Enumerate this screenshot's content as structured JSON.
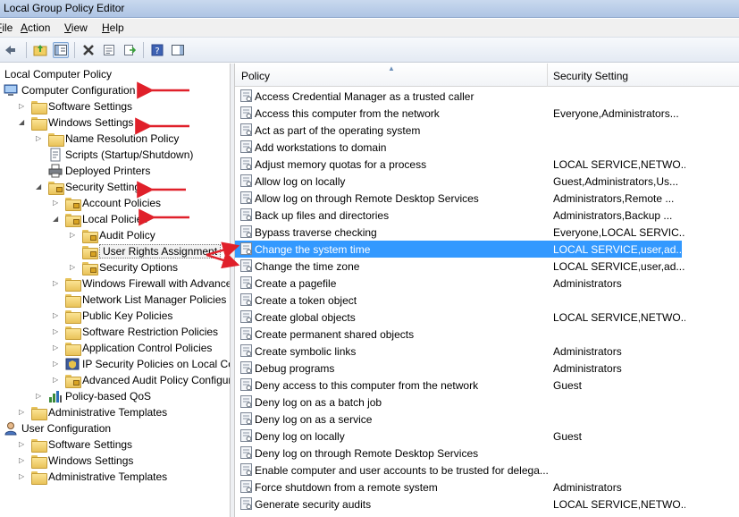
{
  "window": {
    "title": "Local Group Policy Editor"
  },
  "menu": {
    "items": [
      {
        "label": "File",
        "mnemonic": "F",
        "rest": "ile"
      },
      {
        "label": "Action",
        "mnemonic": "A",
        "rest": "ction"
      },
      {
        "label": "View",
        "mnemonic": "V",
        "rest": "iew"
      },
      {
        "label": "Help",
        "mnemonic": "H",
        "rest": "elp"
      }
    ]
  },
  "toolbar": {
    "buttons": [
      "back-icon",
      "forward-icon",
      "up-folder-icon",
      "show-hide-tree-icon",
      "delete-icon",
      "properties-icon",
      "export-list-icon",
      "help-icon",
      "action-pane-icon"
    ]
  },
  "tree": {
    "root": "Local Computer Policy",
    "items": [
      {
        "label": "Computer Configuration",
        "level": 0,
        "expanded": true
      },
      {
        "label": "Software Settings",
        "level": 1
      },
      {
        "label": "Windows Settings",
        "level": 1,
        "expanded": true
      },
      {
        "label": "Name Resolution Policy",
        "level": 2
      },
      {
        "label": "Scripts (Startup/Shutdown)",
        "level": 2
      },
      {
        "label": "Deployed Printers",
        "level": 2
      },
      {
        "label": "Security Settings",
        "level": 2,
        "expanded": true
      },
      {
        "label": "Account Policies",
        "level": 3
      },
      {
        "label": "Local Policies",
        "level": 3,
        "expanded": true
      },
      {
        "label": "Audit Policy",
        "level": 4
      },
      {
        "label": "User Rights Assignment",
        "level": 4,
        "selected": true
      },
      {
        "label": "Security Options",
        "level": 4
      },
      {
        "label": "Windows Firewall with Advanced",
        "level": 3
      },
      {
        "label": "Network List Manager Policies",
        "level": 3
      },
      {
        "label": "Public Key Policies",
        "level": 3
      },
      {
        "label": "Software Restriction Policies",
        "level": 3
      },
      {
        "label": "Application Control Policies",
        "level": 3
      },
      {
        "label": "IP Security Policies on Local Com",
        "level": 3
      },
      {
        "label": "Advanced Audit Policy Configura",
        "level": 3
      },
      {
        "label": "Policy-based QoS",
        "level": 2
      },
      {
        "label": "Administrative Templates",
        "level": 1
      },
      {
        "label": "User Configuration",
        "level": 0
      },
      {
        "label": "Software Settings",
        "level": 1
      },
      {
        "label": "Windows Settings",
        "level": 1
      },
      {
        "label": "Administrative Templates",
        "level": 1
      }
    ]
  },
  "list": {
    "columns": [
      "Policy",
      "Security Setting"
    ],
    "rows": [
      {
        "policy": "Access Credential Manager as a trusted caller",
        "setting": ""
      },
      {
        "policy": "Access this computer from the network",
        "setting": "Everyone,Administrators..."
      },
      {
        "policy": "Act as part of the operating system",
        "setting": ""
      },
      {
        "policy": "Add workstations to domain",
        "setting": ""
      },
      {
        "policy": "Adjust memory quotas for a process",
        "setting": "LOCAL SERVICE,NETWO..."
      },
      {
        "policy": "Allow log on locally",
        "setting": "Guest,Administrators,Us..."
      },
      {
        "policy": "Allow log on through Remote Desktop Services",
        "setting": "Administrators,Remote ..."
      },
      {
        "policy": "Back up files and directories",
        "setting": "Administrators,Backup ..."
      },
      {
        "policy": "Bypass traverse checking",
        "setting": "Everyone,LOCAL SERVIC..."
      },
      {
        "policy": "Change the system time",
        "setting": "LOCAL SERVICE,user,ad...",
        "selected": true
      },
      {
        "policy": "Change the time zone",
        "setting": "LOCAL SERVICE,user,ad..."
      },
      {
        "policy": "Create a pagefile",
        "setting": "Administrators"
      },
      {
        "policy": "Create a token object",
        "setting": ""
      },
      {
        "policy": "Create global objects",
        "setting": "LOCAL SERVICE,NETWO..."
      },
      {
        "policy": "Create permanent shared objects",
        "setting": ""
      },
      {
        "policy": "Create symbolic links",
        "setting": "Administrators"
      },
      {
        "policy": "Debug programs",
        "setting": "Administrators"
      },
      {
        "policy": "Deny access to this computer from the network",
        "setting": "Guest"
      },
      {
        "policy": "Deny log on as a batch job",
        "setting": ""
      },
      {
        "policy": "Deny log on as a service",
        "setting": ""
      },
      {
        "policy": "Deny log on locally",
        "setting": "Guest"
      },
      {
        "policy": "Deny log on through Remote Desktop Services",
        "setting": ""
      },
      {
        "policy": "Enable computer and user accounts to be trusted for delega...",
        "setting": ""
      },
      {
        "policy": "Force shutdown from a remote system",
        "setting": "Administrators"
      },
      {
        "policy": "Generate security audits",
        "setting": "LOCAL SERVICE,NETWO..."
      }
    ]
  },
  "annotations": {
    "arrow_color": "#e0202a"
  }
}
